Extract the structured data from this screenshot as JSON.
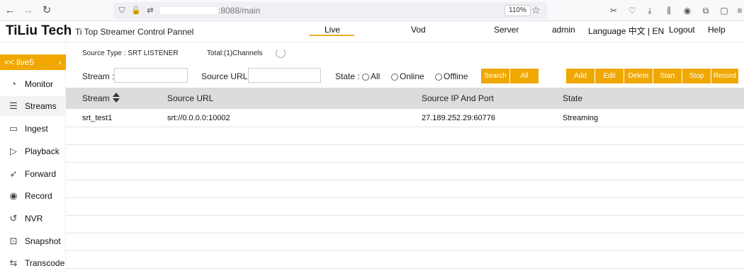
{
  "browser": {
    "url_suffix": ":8088/main",
    "zoom": "110%"
  },
  "app": {
    "brand": "TiLiu Tech",
    "brand_sub": "Ti Top Streamer Control Pannel",
    "nav": {
      "live": "Live",
      "vod": "Vod",
      "server": "Server",
      "user": "admin",
      "language": "Language 中文 | EN",
      "logout": "Logout",
      "help": "Help"
    }
  },
  "sidebar": {
    "header": "<< live5",
    "items": [
      {
        "label": "Monitor"
      },
      {
        "label": "Streams"
      },
      {
        "label": "Ingest"
      },
      {
        "label": "Playback"
      },
      {
        "label": "Forward"
      },
      {
        "label": "Record"
      },
      {
        "label": "NVR"
      },
      {
        "label": "Snapshot"
      },
      {
        "label": "Transcode"
      }
    ]
  },
  "main": {
    "source_type": "Source Type : SRT LISTENER",
    "total": "Total:(1)Channels",
    "filter": {
      "stream_label": "Stream :",
      "stream_value": "",
      "source_url_label": "Source URL :",
      "source_url_value": "",
      "state_label": "State :",
      "radio_all": "All",
      "radio_online": "Online",
      "radio_offline": "Offline"
    },
    "buttons": {
      "search": "Search",
      "all": "All",
      "add": "Add",
      "edit": "Edit",
      "delete": "Delete",
      "start": "Start",
      "stop": "Stop",
      "record": "Record"
    },
    "table": {
      "columns": [
        "Stream",
        "Source URL",
        "Source IP And Port",
        "State"
      ],
      "rows": [
        [
          "srt_test1",
          "srt://0.0.0.0:10002",
          "27.189.252.29:60776",
          "Streaming"
        ]
      ]
    }
  },
  "colors": {
    "accent": "#f0a800",
    "table_header": "#dcdcdc"
  }
}
